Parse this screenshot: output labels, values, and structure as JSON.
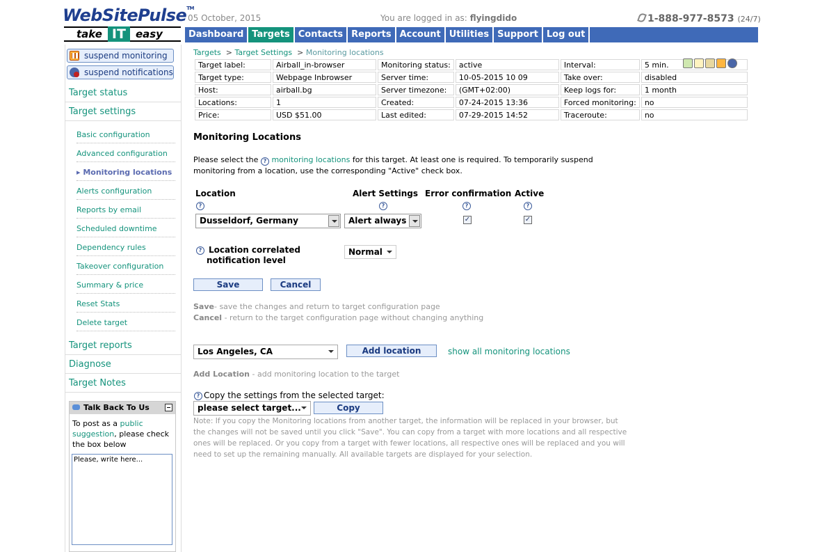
{
  "header": {
    "logo_main": "WebSitePulse",
    "logo_tm": "TM",
    "logo_take": "take",
    "logo_it": "IT",
    "logo_easy": "easy",
    "date": "05 October, 2015",
    "login_prefix": "You are logged in as:",
    "username": "flyingdido",
    "phone": "1-888-977-8573",
    "phone_suffix": "(24/7)"
  },
  "nav": {
    "items": [
      {
        "label": "Dashboard"
      },
      {
        "label": "Targets"
      },
      {
        "label": "Contacts"
      },
      {
        "label": "Reports"
      },
      {
        "label": "Account"
      },
      {
        "label": "Utilities"
      },
      {
        "label": "Support"
      },
      {
        "label": "Log out"
      }
    ],
    "active": "Targets"
  },
  "sidebar": {
    "suspend_monitoring": "suspend monitoring",
    "suspend_notifications": "suspend notifications",
    "target_status": "Target status",
    "target_settings": "Target settings",
    "sub_items": [
      {
        "label": "Basic configuration"
      },
      {
        "label": "Advanced configuration"
      },
      {
        "label": "▸ Monitoring locations"
      },
      {
        "label": "Alerts configuration"
      },
      {
        "label": "Reports by email"
      },
      {
        "label": "Scheduled downtime"
      },
      {
        "label": "Dependency rules"
      },
      {
        "label": "Takeover configuration"
      },
      {
        "label": "Summary & price"
      },
      {
        "label": "Reset Stats"
      },
      {
        "label": "Delete target"
      }
    ],
    "target_reports": "Target reports",
    "diagnose": "Diagnose",
    "target_notes": "Target Notes",
    "talk": {
      "title": "Talk Back To Us",
      "text_1": "To post as a",
      "link": "public suggestion",
      "text_2": ", please check the box below",
      "placeholder": "Please, write here..."
    }
  },
  "breadcrumb": {
    "targets": "Targets",
    "sep": ">",
    "settings": "Target Settings",
    "current": "Monitoring locations"
  },
  "info": {
    "rows": [
      [
        "Target label:",
        "Airball_in-browser",
        "Monitoring status:",
        "active",
        "Interval:",
        "5 min."
      ],
      [
        "Target type:",
        "Webpage Inbrowser",
        "Server time:",
        "10-05-2015 10 09",
        "Take over:",
        "disabled"
      ],
      [
        "Host:",
        "airball.bg",
        "Server timezone:",
        "(GMT+02:00)",
        "Keep logs for:",
        "1 month"
      ],
      [
        "Locations:",
        "1",
        "Created:",
        "07-24-2015 13:36",
        "Forced monitoring:",
        "no"
      ],
      [
        "Price:",
        "USD $51.00",
        "Last edited:",
        "07-29-2015 14:52",
        "Traceroute:",
        "no"
      ]
    ]
  },
  "main": {
    "heading": "Monitoring Locations",
    "desc_1": "Please select the",
    "desc_link": "monitoring locations",
    "desc_2": "for this target. At least one is required. To temporarily suspend monitoring from a location, use the corresponding \"Active\" check box.",
    "col_location": "Location",
    "col_alert": "Alert Settings",
    "col_error": "Error confirmation",
    "col_active": "Active",
    "help_glyph": "?",
    "location_value": "Dusseldorf, Germany",
    "alert_value": "Alert always",
    "check_glyph": "✓",
    "correlated_label_1": "Location correlated",
    "correlated_label_2": "notification level",
    "correlated_value": "Normal",
    "save": "Save",
    "cancel": "Cancel",
    "note_save_b": "Save",
    "note_save": "- save the changes and return to target configuration page",
    "note_cancel_b": "Cancel",
    "note_cancel": " - return to the target configuration page without changing anything",
    "add_select": "Los Angeles, CA",
    "add_button": "Add location",
    "show_all": "show all monitoring locations",
    "note_add_b": "Add Location",
    "note_add": " - add monitoring location to the target",
    "copy_label": "Copy the settings from the selected target:",
    "copy_select": "please select target...",
    "copy_button": "Copy",
    "copy_note": "Note: If you copy the Monitoring locations from another target, the information will be replaced in your browser, but the changes will not be saved until you click \"Save\". You can copy from a target with more locations and all respective ones will be replaced. Or you copy from a target with fewer locations, all respective ones will be replaced and you will need to set up the remaining manually. All available targets are displayed for your selection."
  }
}
